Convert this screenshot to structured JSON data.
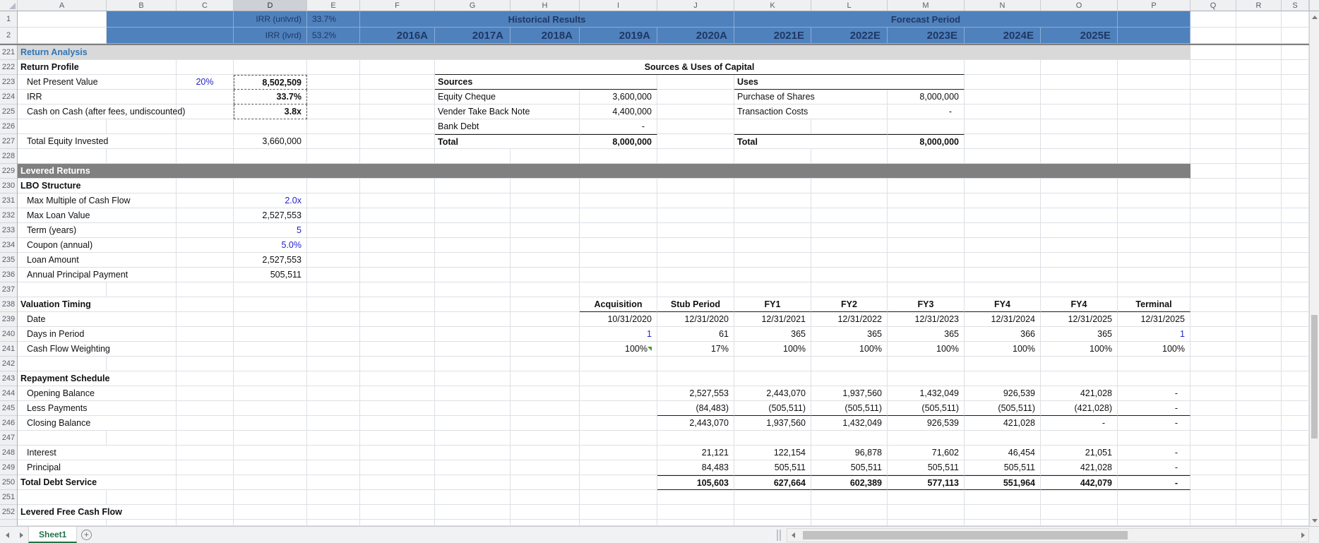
{
  "colors": {
    "hdrblue": "#4F81BD",
    "navy": "#1F3864",
    "input": "#2222CC",
    "secblue": "#2E75B6",
    "band1": "#D9D9D9",
    "band2": "#808080",
    "tabgreen": "#217346",
    "grid": "#DCE0E5"
  },
  "tabbar": {
    "tab": "Sheet1",
    "new_tab": "+"
  },
  "sheet": {
    "selected_column": "D",
    "col_letters": [
      "A",
      "B",
      "C",
      "D",
      "E",
      "F",
      "G",
      "H",
      "I",
      "J",
      "K",
      "L",
      "M",
      "N",
      "O",
      "P",
      "Q",
      "R",
      "S"
    ],
    "frozen_rows": [
      {
        "num": "1",
        "cells": [
          {
            "c": "B",
            "n": 2,
            "s": "hb"
          },
          {
            "c": "D",
            "t": "IRR (unlvrd)",
            "s": "hb r hlabel"
          },
          {
            "c": "E",
            "t": "33.7%",
            "s": "hb l hlabel"
          },
          {
            "c": "F",
            "n": 5,
            "t": "Historical Results",
            "s": "hb c htitle"
          },
          {
            "c": "K",
            "n": 5,
            "t": "Forecast Period",
            "s": "hb c htitle"
          },
          {
            "c": "P",
            "s": "hb"
          }
        ]
      },
      {
        "num": "2",
        "cells": [
          {
            "c": "B",
            "n": 2,
            "s": "hb"
          },
          {
            "c": "D",
            "t": "IRR (lvrd)",
            "s": "hb r hlabel"
          },
          {
            "c": "E",
            "t": "53.2%",
            "s": "hb l hlabel"
          },
          {
            "c": "F",
            "t": "2016A",
            "s": "hb r hyear"
          },
          {
            "c": "G",
            "t": "2017A",
            "s": "hb r hyear"
          },
          {
            "c": "H",
            "t": "2018A",
            "s": "hb r hyear"
          },
          {
            "c": "I",
            "t": "2019A",
            "s": "hb r hyear"
          },
          {
            "c": "J",
            "t": "2020A",
            "s": "hb r hyear"
          },
          {
            "c": "K",
            "t": "2021E",
            "s": "hb r hyear"
          },
          {
            "c": "L",
            "t": "2022E",
            "s": "hb r hyear"
          },
          {
            "c": "M",
            "t": "2023E",
            "s": "hb r hyear"
          },
          {
            "c": "N",
            "t": "2024E",
            "s": "hb r hyear"
          },
          {
            "c": "O",
            "t": "2025E",
            "s": "hb r hyear"
          },
          {
            "c": "P",
            "s": "hb"
          }
        ]
      }
    ],
    "rows": [
      {
        "num": "221",
        "cells": [
          {
            "c": "A",
            "n": 16,
            "t": "Return Analysis",
            "s": "band1 secb b"
          }
        ]
      },
      {
        "num": "222",
        "cells": [
          {
            "c": "A",
            "n": 2,
            "t": "Return Profile",
            "s": "b"
          },
          {
            "c": "G",
            "n": 7,
            "t": "Sources & Uses of Capital",
            "s": "b c bb"
          }
        ]
      },
      {
        "num": "223",
        "cells": [
          {
            "c": "A",
            "n": 2,
            "t": "Net Present Value",
            "s": "ind"
          },
          {
            "c": "C",
            "t": "20%",
            "s": "blu c"
          },
          {
            "c": "D",
            "t": "8,502,509",
            "s": "b r dash dash-top"
          },
          {
            "c": "G",
            "n": 3,
            "t": "Sources",
            "s": "b bb"
          },
          {
            "c": "K",
            "n": 3,
            "t": "Uses",
            "s": "b bb"
          }
        ]
      },
      {
        "num": "224",
        "cells": [
          {
            "c": "A",
            "n": 2,
            "t": "IRR",
            "s": "ind"
          },
          {
            "c": "D",
            "t": "33.7%",
            "s": "b r dash"
          },
          {
            "c": "G",
            "n": 2,
            "t": "Equity Cheque",
            "s": ""
          },
          {
            "c": "I",
            "t": "3,600,000",
            "s": "r"
          },
          {
            "c": "K",
            "n": 2,
            "t": "Purchase of Shares",
            "s": ""
          },
          {
            "c": "M",
            "t": "8,000,000",
            "s": "r"
          }
        ]
      },
      {
        "num": "225",
        "cells": [
          {
            "c": "A",
            "n": 2,
            "t": "Cash on Cash (after fees, undiscounted)",
            "s": "ind"
          },
          {
            "c": "D",
            "t": "3.8x",
            "s": "b r dash"
          },
          {
            "c": "G",
            "n": 2,
            "t": "Vender Take Back Note",
            "s": ""
          },
          {
            "c": "I",
            "t": "4,400,000",
            "s": "r"
          },
          {
            "c": "K",
            "n": 2,
            "t": "Transaction Costs",
            "s": ""
          },
          {
            "c": "M",
            "t": "-",
            "s": "r"
          }
        ]
      },
      {
        "num": "226",
        "cells": [
          {
            "c": "G",
            "n": 2,
            "t": "Bank Debt",
            "s": ""
          },
          {
            "c": "I",
            "t": "-",
            "s": "r"
          }
        ]
      },
      {
        "num": "227",
        "cells": [
          {
            "c": "A",
            "n": 2,
            "t": "Total Equity Invested",
            "s": "ind"
          },
          {
            "c": "D",
            "t": "3,660,000",
            "s": "r"
          },
          {
            "c": "G",
            "n": 2,
            "t": "Total",
            "s": "b bt"
          },
          {
            "c": "I",
            "t": "8,000,000",
            "s": "b r bt"
          },
          {
            "c": "K",
            "n": 2,
            "t": "Total",
            "s": "b bt"
          },
          {
            "c": "M",
            "t": "8,000,000",
            "s": "b r bt"
          }
        ]
      },
      {
        "num": "228",
        "cells": []
      },
      {
        "num": "229",
        "cells": [
          {
            "c": "A",
            "n": 16,
            "t": "Levered Returns",
            "s": "band2 b"
          }
        ]
      },
      {
        "num": "230",
        "cells": [
          {
            "c": "A",
            "n": 2,
            "t": "LBO Structure",
            "s": "b"
          }
        ]
      },
      {
        "num": "231",
        "cells": [
          {
            "c": "A",
            "n": 2,
            "t": "Max Multiple of Cash Flow",
            "s": "ind"
          },
          {
            "c": "D",
            "t": "2.0x",
            "s": "blu r"
          }
        ]
      },
      {
        "num": "232",
        "cells": [
          {
            "c": "A",
            "n": 2,
            "t": "Max Loan Value",
            "s": "ind"
          },
          {
            "c": "D",
            "t": "2,527,553",
            "s": "r"
          }
        ]
      },
      {
        "num": "233",
        "cells": [
          {
            "c": "A",
            "n": 2,
            "t": "Term (years)",
            "s": "ind"
          },
          {
            "c": "D",
            "t": "5",
            "s": "blu r"
          }
        ]
      },
      {
        "num": "234",
        "cells": [
          {
            "c": "A",
            "n": 2,
            "t": "Coupon (annual)",
            "s": "ind"
          },
          {
            "c": "D",
            "t": "5.0%",
            "s": "blu r"
          }
        ]
      },
      {
        "num": "235",
        "cells": [
          {
            "c": "A",
            "n": 2,
            "t": "Loan Amount",
            "s": "ind"
          },
          {
            "c": "D",
            "t": "2,527,553",
            "s": "r"
          }
        ]
      },
      {
        "num": "236",
        "cells": [
          {
            "c": "A",
            "n": 2,
            "t": "Annual Principal Payment",
            "s": "ind"
          },
          {
            "c": "D",
            "t": "505,511",
            "s": "r"
          }
        ]
      },
      {
        "num": "237",
        "cells": []
      },
      {
        "num": "238",
        "cells": [
          {
            "c": "A",
            "n": 2,
            "t": "Valuation Timing",
            "s": "b"
          },
          {
            "c": "I",
            "t": "Acquisition",
            "s": "b c bb"
          },
          {
            "c": "J",
            "t": "Stub Period",
            "s": "b c bb"
          },
          {
            "c": "K",
            "t": "FY1",
            "s": "b c bb"
          },
          {
            "c": "L",
            "t": "FY2",
            "s": "b c bb"
          },
          {
            "c": "M",
            "t": "FY3",
            "s": "b c bb"
          },
          {
            "c": "N",
            "t": "FY4",
            "s": "b c bb"
          },
          {
            "c": "O",
            "t": "FY4",
            "s": "b c bb"
          },
          {
            "c": "P",
            "t": "Terminal",
            "s": "b c bb"
          }
        ]
      },
      {
        "num": "239",
        "cells": [
          {
            "c": "A",
            "n": 2,
            "t": "Date",
            "s": "ind"
          },
          {
            "c": "I",
            "t": "10/31/2020",
            "s": "r"
          },
          {
            "c": "J",
            "t": "12/31/2020",
            "s": "r"
          },
          {
            "c": "K",
            "t": "12/31/2021",
            "s": "r"
          },
          {
            "c": "L",
            "t": "12/31/2022",
            "s": "r"
          },
          {
            "c": "M",
            "t": "12/31/2023",
            "s": "r"
          },
          {
            "c": "N",
            "t": "12/31/2024",
            "s": "r"
          },
          {
            "c": "O",
            "t": "12/31/2025",
            "s": "r"
          },
          {
            "c": "P",
            "t": "12/31/2025",
            "s": "r"
          }
        ]
      },
      {
        "num": "240",
        "cells": [
          {
            "c": "A",
            "n": 2,
            "t": "Days in Period",
            "s": "ind"
          },
          {
            "c": "I",
            "t": "1",
            "s": "blu r"
          },
          {
            "c": "J",
            "t": "61",
            "s": "r"
          },
          {
            "c": "K",
            "t": "365",
            "s": "r"
          },
          {
            "c": "L",
            "t": "365",
            "s": "r"
          },
          {
            "c": "M",
            "t": "365",
            "s": "r"
          },
          {
            "c": "N",
            "t": "366",
            "s": "r"
          },
          {
            "c": "O",
            "t": "365",
            "s": "r"
          },
          {
            "c": "P",
            "t": "1",
            "s": "blu r"
          }
        ]
      },
      {
        "num": "241",
        "cells": [
          {
            "c": "A",
            "n": 2,
            "t": "Cash Flow Weighting",
            "s": "ind"
          },
          {
            "c": "I",
            "t": "100%",
            "s": "r grn"
          },
          {
            "c": "J",
            "t": "17%",
            "s": "r"
          },
          {
            "c": "K",
            "t": "100%",
            "s": "r"
          },
          {
            "c": "L",
            "t": "100%",
            "s": "r"
          },
          {
            "c": "M",
            "t": "100%",
            "s": "r"
          },
          {
            "c": "N",
            "t": "100%",
            "s": "r"
          },
          {
            "c": "O",
            "t": "100%",
            "s": "r"
          },
          {
            "c": "P",
            "t": "100%",
            "s": "r"
          }
        ]
      },
      {
        "num": "242",
        "cells": []
      },
      {
        "num": "243",
        "cells": [
          {
            "c": "A",
            "n": 2,
            "t": "Repayment Schedule",
            "s": "b"
          }
        ]
      },
      {
        "num": "244",
        "cells": [
          {
            "c": "A",
            "n": 2,
            "t": "Opening Balance",
            "s": "ind"
          },
          {
            "c": "J",
            "t": "2,527,553",
            "s": "r"
          },
          {
            "c": "K",
            "t": "2,443,070",
            "s": "r"
          },
          {
            "c": "L",
            "t": "1,937,560",
            "s": "r"
          },
          {
            "c": "M",
            "t": "1,432,049",
            "s": "r"
          },
          {
            "c": "N",
            "t": "926,539",
            "s": "r"
          },
          {
            "c": "O",
            "t": "421,028",
            "s": "r"
          },
          {
            "c": "P",
            "t": "-",
            "s": "r"
          }
        ]
      },
      {
        "num": "245",
        "cells": [
          {
            "c": "A",
            "n": 2,
            "t": "Less Payments",
            "s": "ind"
          },
          {
            "c": "J",
            "t": "(84,483)",
            "s": "r bb"
          },
          {
            "c": "K",
            "t": "(505,511)",
            "s": "r bb"
          },
          {
            "c": "L",
            "t": "(505,511)",
            "s": "r bb"
          },
          {
            "c": "M",
            "t": "(505,511)",
            "s": "r bb"
          },
          {
            "c": "N",
            "t": "(505,511)",
            "s": "r bb"
          },
          {
            "c": "O",
            "t": "(421,028)",
            "s": "r bb"
          },
          {
            "c": "P",
            "t": "-",
            "s": "r bb"
          }
        ]
      },
      {
        "num": "246",
        "cells": [
          {
            "c": "A",
            "n": 2,
            "t": "Closing Balance",
            "s": "ind"
          },
          {
            "c": "J",
            "t": "2,443,070",
            "s": "r"
          },
          {
            "c": "K",
            "t": "1,937,560",
            "s": "r"
          },
          {
            "c": "L",
            "t": "1,432,049",
            "s": "r"
          },
          {
            "c": "M",
            "t": "926,539",
            "s": "r"
          },
          {
            "c": "N",
            "t": "421,028",
            "s": "r"
          },
          {
            "c": "O",
            "t": "-",
            "s": "r"
          },
          {
            "c": "P",
            "t": "-",
            "s": "r"
          }
        ]
      },
      {
        "num": "247",
        "cells": []
      },
      {
        "num": "248",
        "cells": [
          {
            "c": "A",
            "n": 2,
            "t": "Interest",
            "s": "ind"
          },
          {
            "c": "J",
            "t": "21,121",
            "s": "r"
          },
          {
            "c": "K",
            "t": "122,154",
            "s": "r"
          },
          {
            "c": "L",
            "t": "96,878",
            "s": "r"
          },
          {
            "c": "M",
            "t": "71,602",
            "s": "r"
          },
          {
            "c": "N",
            "t": "46,454",
            "s": "r"
          },
          {
            "c": "O",
            "t": "21,051",
            "s": "r"
          },
          {
            "c": "P",
            "t": "-",
            "s": "r"
          }
        ]
      },
      {
        "num": "249",
        "cells": [
          {
            "c": "A",
            "n": 2,
            "t": "Principal",
            "s": "ind"
          },
          {
            "c": "J",
            "t": "84,483",
            "s": "r"
          },
          {
            "c": "K",
            "t": "505,511",
            "s": "r"
          },
          {
            "c": "L",
            "t": "505,511",
            "s": "r"
          },
          {
            "c": "M",
            "t": "505,511",
            "s": "r"
          },
          {
            "c": "N",
            "t": "505,511",
            "s": "r"
          },
          {
            "c": "O",
            "t": "421,028",
            "s": "r"
          },
          {
            "c": "P",
            "t": "-",
            "s": "r"
          }
        ]
      },
      {
        "num": "250",
        "cells": [
          {
            "c": "A",
            "n": 2,
            "t": "Total Debt Service",
            "s": "b"
          },
          {
            "c": "J",
            "t": "105,603",
            "s": "b r bt bb"
          },
          {
            "c": "K",
            "t": "627,664",
            "s": "b r bt bb"
          },
          {
            "c": "L",
            "t": "602,389",
            "s": "b r bt bb"
          },
          {
            "c": "M",
            "t": "577,113",
            "s": "b r bt bb"
          },
          {
            "c": "N",
            "t": "551,964",
            "s": "b r bt bb"
          },
          {
            "c": "O",
            "t": "442,079",
            "s": "b r bt bb"
          },
          {
            "c": "P",
            "t": "-",
            "s": "b r bt bb"
          }
        ]
      },
      {
        "num": "251",
        "cells": []
      },
      {
        "num": "252",
        "cells": [
          {
            "c": "A",
            "n": 2,
            "t": "Levered Free Cash Flow",
            "s": "b"
          }
        ]
      }
    ]
  }
}
